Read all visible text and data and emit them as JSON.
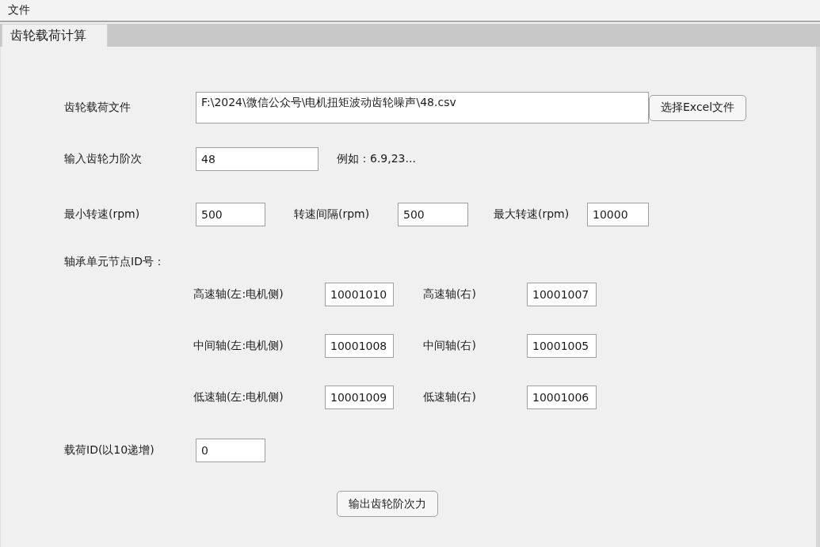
{
  "menu": [
    "文件"
  ],
  "tabs": [
    {
      "label": "齿轮载荷计算",
      "selected": true
    }
  ],
  "file": {
    "label": "齿轮载荷文件",
    "value": "F:\\2024\\微信公众号\\电机扭矩波动齿轮噪声\\48.csv",
    "button": "选择Excel文件"
  },
  "order": {
    "label": "输入齿轮力阶次",
    "value": "48",
    "hint": "例如：6.9,23..."
  },
  "speeds": [
    {
      "label": "最小转速(rpm)",
      "value": "500"
    },
    {
      "label": "转速间隔(rpm)",
      "value": "500"
    },
    {
      "label": "最大转速(rpm)",
      "value": "10000"
    }
  ],
  "bearings": {
    "title": "轴承单元节点ID号：",
    "rows": [
      {
        "left_label": "高速轴(左:电机侧)",
        "left_value": "10001010",
        "right_label": "高速轴(右)",
        "right_value": "10001007"
      },
      {
        "left_label": "中间轴(左:电机侧)",
        "left_value": "10001008",
        "right_label": "中间轴(右)",
        "right_value": "10001005"
      },
      {
        "left_label": "低速轴(左:电机侧)",
        "left_value": "10001009",
        "right_label": "低速轴(右)",
        "right_value": "10001006"
      }
    ]
  },
  "load_id": {
    "label": "载荷ID(以10递增)",
    "value": "0"
  },
  "submit": "输出齿轮阶次力"
}
